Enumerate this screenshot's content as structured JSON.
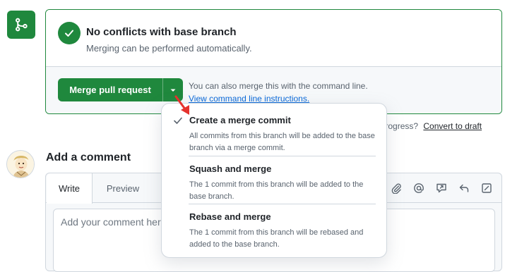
{
  "merge_status": {
    "title": "No conflicts with base branch",
    "subtitle": "Merging can be performed automatically."
  },
  "merge_actions": {
    "merge_button_label": "Merge pull request",
    "command_line_hint": "You can also merge this with the command line.",
    "command_line_link": "View command line instructions."
  },
  "draft": {
    "text": "l in progress?",
    "convert_link": "Convert to draft"
  },
  "comment": {
    "heading": "Add a comment",
    "tabs": [
      {
        "label": "Write",
        "selected": true
      },
      {
        "label": "Preview",
        "selected": false
      }
    ],
    "placeholder": "Add your comment her",
    "toolbar_icons": [
      "paperclip-icon",
      "mention-icon",
      "cross-reference-icon",
      "reply-icon",
      "fullscreen-icon"
    ]
  },
  "merge_menu": {
    "items": [
      {
        "title": "Create a merge commit",
        "description": "All commits from this branch will be added to the base branch via a merge commit.",
        "selected": true
      },
      {
        "title": "Squash and merge",
        "description": "The 1 commit from this branch will be added to the base branch.",
        "selected": false
      },
      {
        "title": "Rebase and merge",
        "description": "The 1 commit from this branch will be rebased and added to the base branch.",
        "selected": false
      }
    ]
  },
  "colors": {
    "success_green": "#1f883d",
    "link_blue": "#0969da",
    "annotation_red": "#e5322d",
    "border_gray": "#d0d7de"
  }
}
